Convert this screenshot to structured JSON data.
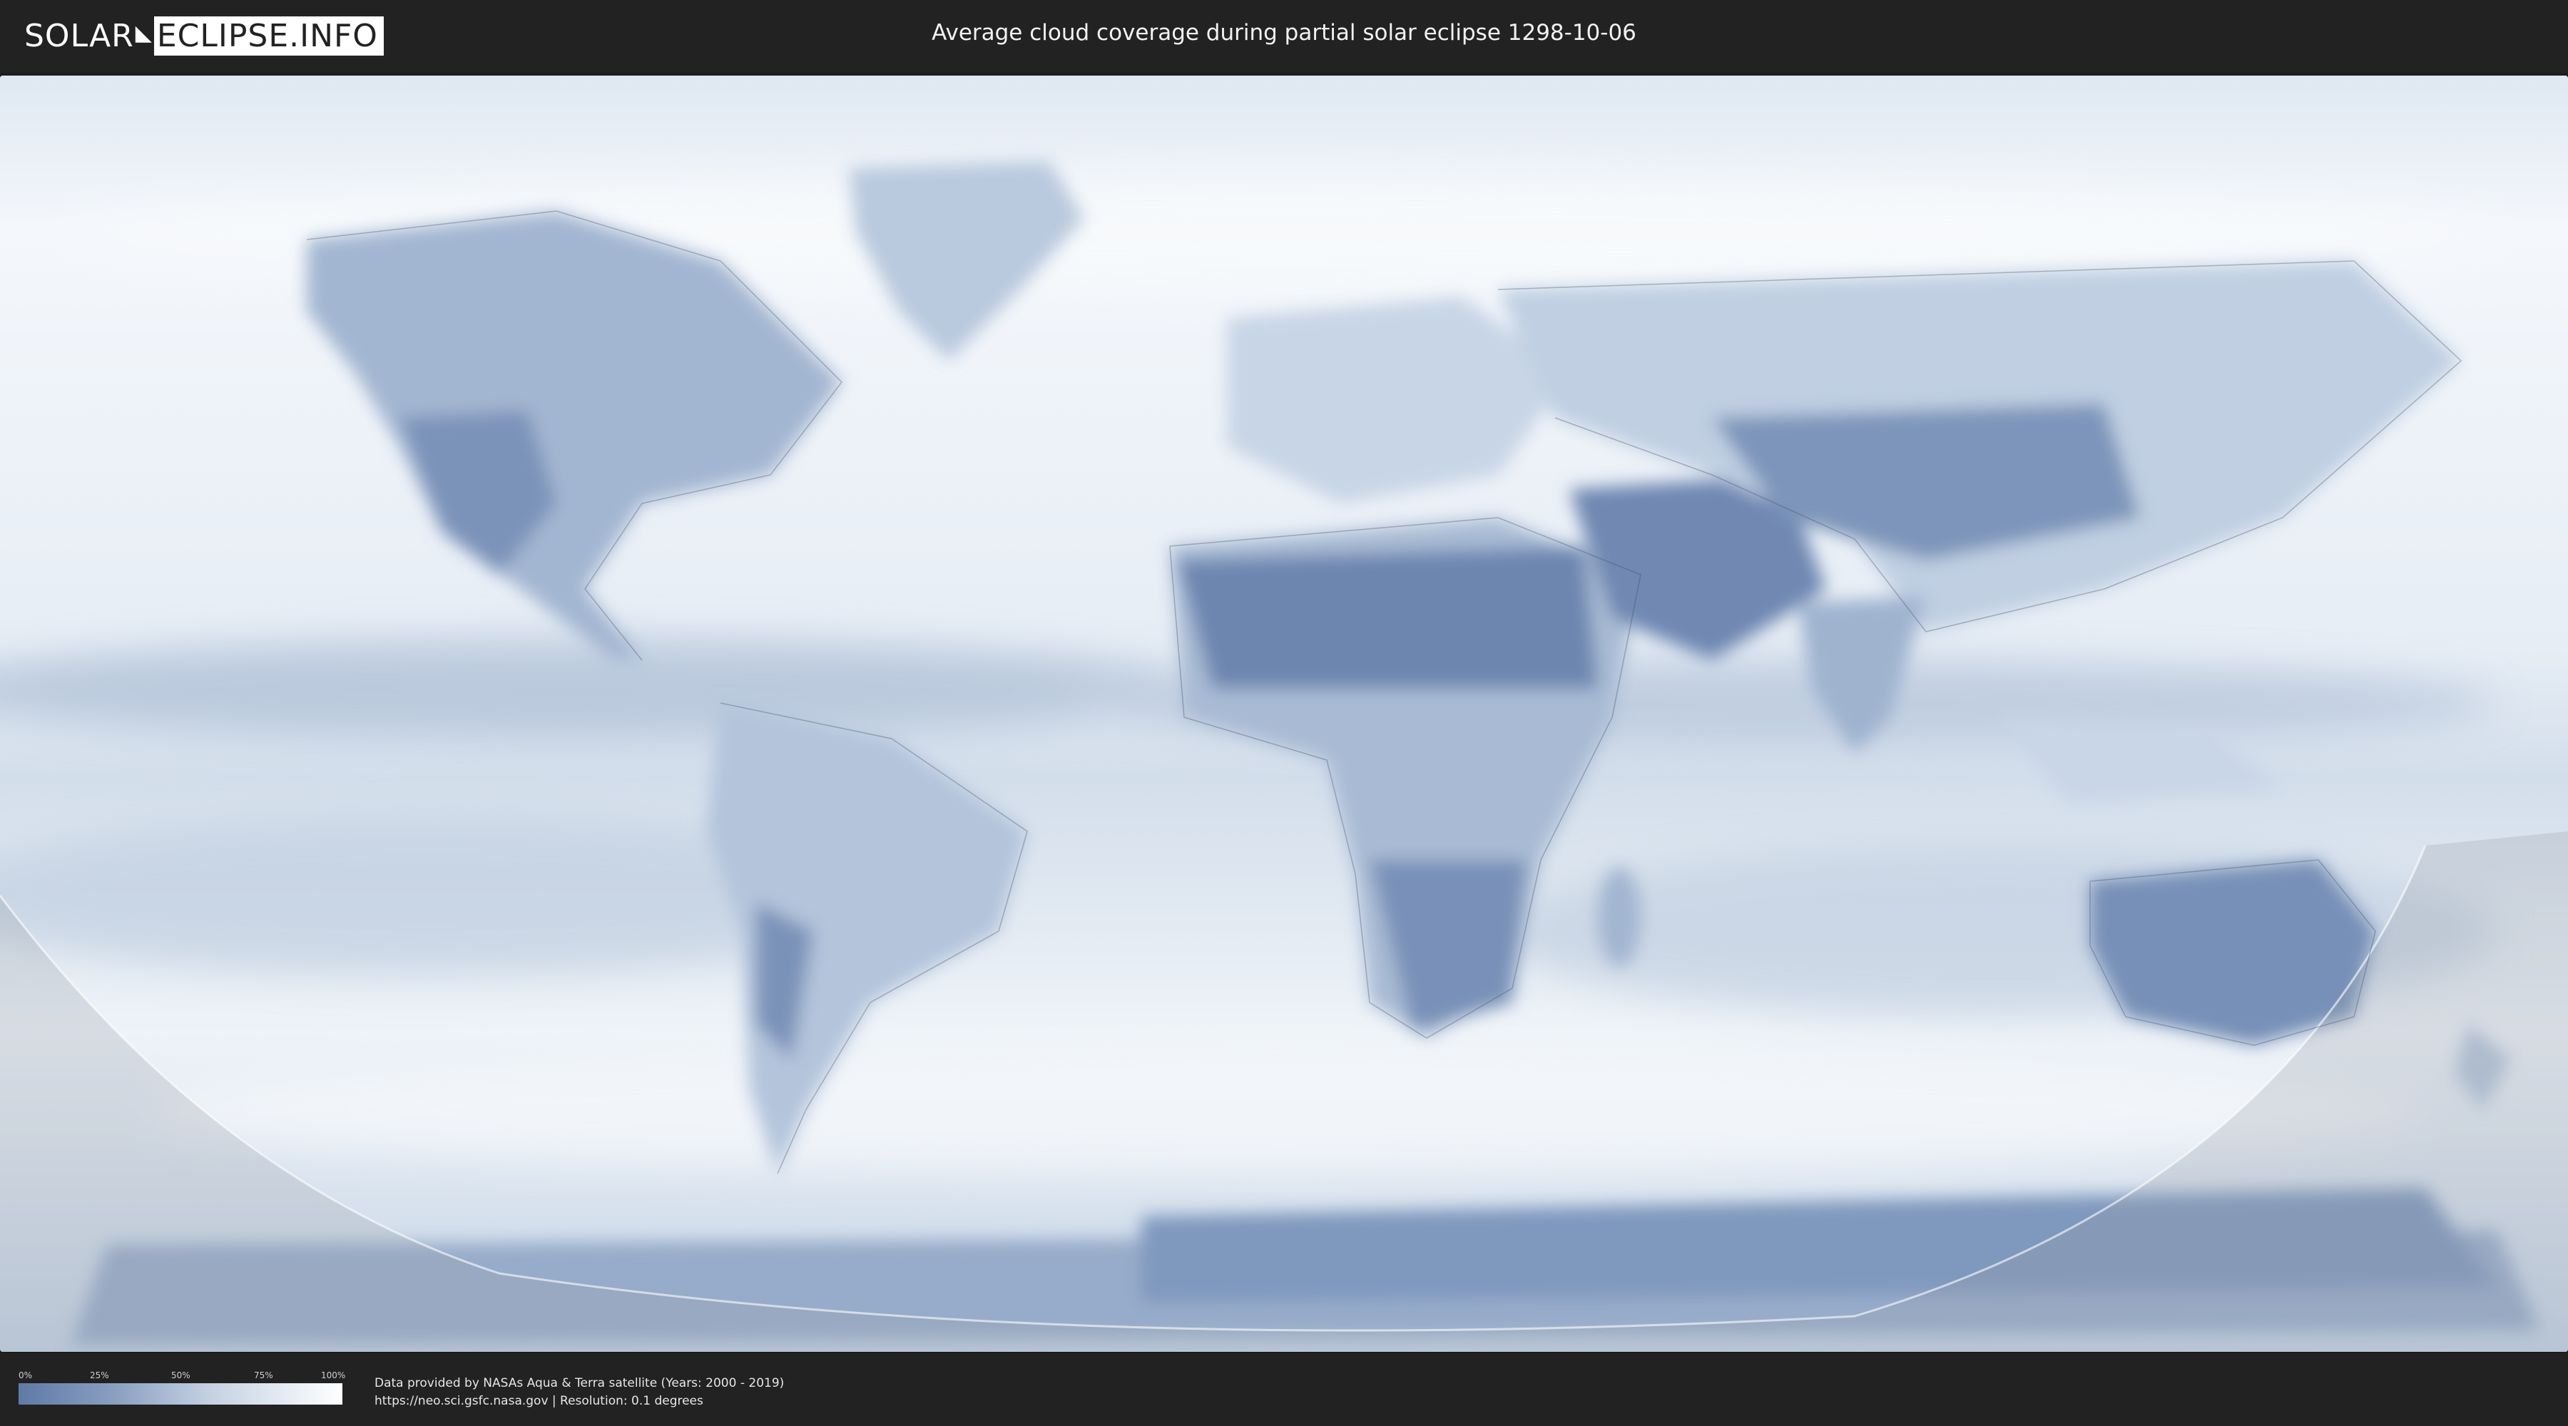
{
  "header": {
    "logo_left": "SOLAR",
    "logo_right": "ECLIPSE.INFO",
    "title": "Average cloud coverage during partial solar eclipse 1298-10-06"
  },
  "map": {
    "colors": {
      "clear": "#5f7aa6",
      "mid": "#a9bcd6",
      "cloudy": "#f4f7fb",
      "border": "#3d4a63"
    },
    "icon": "world-cloud-cover-map"
  },
  "legend": {
    "ticks": [
      "0%",
      "25%",
      "50%",
      "75%",
      "100%"
    ],
    "stops": [
      0,
      25,
      50,
      75,
      100
    ]
  },
  "credits": {
    "line1": "Data provided by NASAs Aqua & Terra satellite (Years: 2000 - 2019)",
    "line2": "https://neo.sci.gsfc.nasa.gov | Resolution: 0.1 degrees"
  }
}
